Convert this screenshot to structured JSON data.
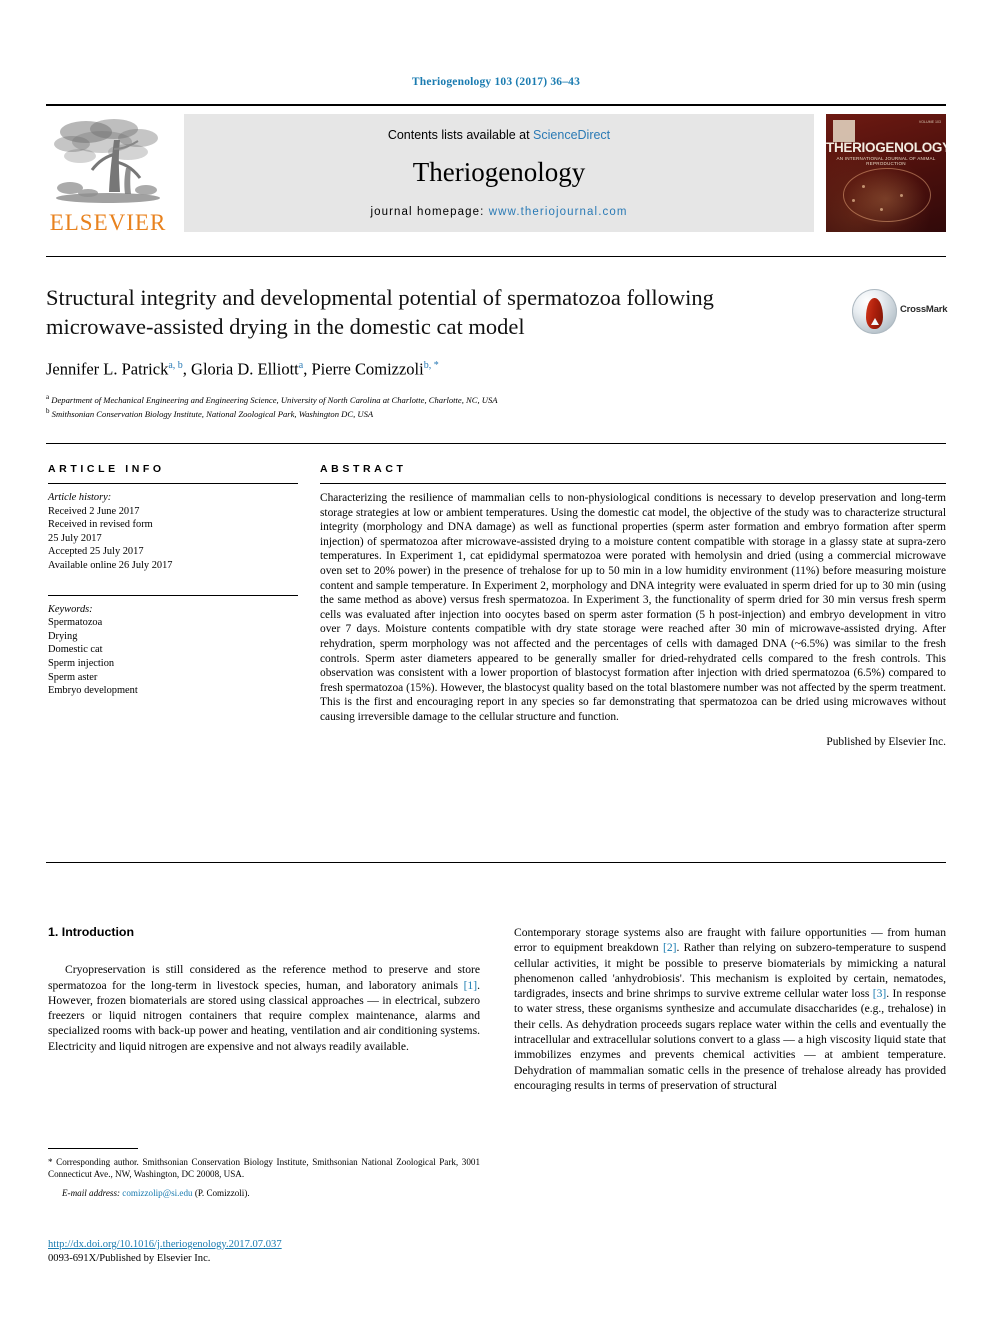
{
  "running_head": "Theriogenology 103 (2017) 36–43",
  "masthead": {
    "publisher_logo_name": "elsevier-tree-logo",
    "publisher_word": "ELSEVIER",
    "contents_prefix": "Contents lists available at ",
    "contents_link": "ScienceDirect",
    "journal_title": "Theriogenology",
    "homepage_label": "journal homepage: ",
    "homepage_url": "www.theriojournal.com",
    "cover": {
      "journal_name": "THERIOGENOLOGY",
      "subtitle": "AN INTERNATIONAL JOURNAL OF ANIMAL REPRODUCTION",
      "corner_text": "VOLUME 103"
    }
  },
  "article": {
    "title": "Structural integrity and developmental potential of spermatozoa following microwave-assisted drying in the domestic cat model",
    "authors": [
      {
        "name": "Jennifer L. Patrick",
        "marks": "a, b"
      },
      {
        "name": "Gloria D. Elliott",
        "marks": "a"
      },
      {
        "name": "Pierre Comizzoli",
        "marks": "b, *"
      }
    ],
    "affiliations": [
      {
        "mark": "a",
        "text": "Department of Mechanical Engineering and Engineering Science, University of North Carolina at Charlotte, Charlotte, NC, USA"
      },
      {
        "mark": "b",
        "text": "Smithsonian Conservation Biology Institute, National Zoological Park, Washington DC, USA"
      }
    ],
    "crossmark_label": "CrossMark"
  },
  "article_info": {
    "heading": "ARTICLE INFO",
    "history_label": "Article history:",
    "history": [
      "Received 2 June 2017",
      "Received in revised form",
      "25 July 2017",
      "Accepted 25 July 2017",
      "Available online 26 July 2017"
    ],
    "keywords_label": "Keywords:",
    "keywords": [
      "Spermatozoa",
      "Drying",
      "Domestic cat",
      "Sperm injection",
      "Sperm aster",
      "Embryo development"
    ]
  },
  "abstract": {
    "heading": "ABSTRACT",
    "text": "Characterizing the resilience of mammalian cells to non-physiological conditions is necessary to develop preservation and long-term storage strategies at low or ambient temperatures. Using the domestic cat model, the objective of the study was to characterize structural integrity (morphology and DNA damage) as well as functional properties (sperm aster formation and embryo formation after sperm injection) of spermatozoa after microwave-assisted drying to a moisture content compatible with storage in a glassy state at supra-zero temperatures. In Experiment 1, cat epididymal spermatozoa were porated with hemolysin and dried (using a commercial microwave oven set to 20% power) in the presence of trehalose for up to 50 min in a low humidity environment (11%) before measuring moisture content and sample temperature. In Experiment 2, morphology and DNA integrity were evaluated in sperm dried for up to 30 min (using the same method as above) versus fresh spermatozoa. In Experiment 3, the functionality of sperm dried for 30 min versus fresh sperm cells was evaluated after injection into oocytes based on sperm aster formation (5 h post-injection) and embryo development in vitro over 7 days. Moisture contents compatible with dry state storage were reached after 30 min of microwave-assisted drying. After rehydration, sperm morphology was not affected and the percentages of cells with damaged DNA (~6.5%) was similar to the fresh controls. Sperm aster diameters appeared to be generally smaller for dried-rehydrated cells compared to the fresh controls. This observation was consistent with a lower proportion of blastocyst formation after injection with dried spermatozoa (6.5%) compared to fresh spermatozoa (15%). However, the blastocyst quality based on the total blastomere number was not affected by the sperm treatment. This is the first and encouraging report in any species so far demonstrating that spermatozoa can be dried using microwaves without causing irreversible damage to the cellular structure and function.",
    "published_by": "Published by Elsevier Inc."
  },
  "body": {
    "section_heading": "1. Introduction",
    "left_paragraph_part1": "Cryopreservation is still considered as the reference method to preserve and store spermatozoa for the long-term in livestock species, human, and laboratory animals ",
    "left_cite1": "[1]",
    "left_paragraph_part2": ". However, frozen biomaterials are stored using classical approaches — in electrical, subzero freezers or liquid nitrogen containers that require complex maintenance, alarms and specialized rooms with back-up power and heating, ventilation and air conditioning systems. Electricity and liquid nitrogen are expensive and not always readily available.",
    "right_paragraph_part1": "Contemporary storage systems also are fraught with failure opportunities — from human error to equipment breakdown ",
    "right_cite1": "[2]",
    "right_paragraph_part2": ". Rather than relying on subzero-temperature to suspend cellular activities, it might be possible to preserve biomaterials by mimicking a natural phenomenon called 'anhydrobiosis'. This mechanism is exploited by certain, nematodes, tardigrades, insects and brine shrimps to survive extreme cellular water loss ",
    "right_cite2": "[3]",
    "right_paragraph_part3": ". In response to water stress, these organisms synthesize and accumulate disaccharides (e.g., trehalose) in their cells. As dehydration proceeds sugars replace water within the cells and eventually the intracellular and extracellular solutions convert to a glass — a high viscosity liquid state that immobilizes enzymes and prevents chemical activities — at ambient temperature. Dehydration of mammalian somatic cells in the presence of trehalose already has provided encouraging results in terms of preservation of structural"
  },
  "footnotes": {
    "corresponding": "* Corresponding author. Smithsonian Conservation Biology Institute, Smithsonian National Zoological Park, 3001 Connecticut Ave., NW, Washington, DC 20008, USA.",
    "email_label": "E-mail address: ",
    "email": "comizzolip@si.edu",
    "email_suffix": " (P. Comizzoli)."
  },
  "imprint": {
    "doi": "http://dx.doi.org/10.1016/j.theriogenology.2017.07.037",
    "issn_line": "0093-691X/Published by Elsevier Inc."
  },
  "colors": {
    "link_blue": "#1a7bb0",
    "elsevier_orange": "#e8821e",
    "banner_gray": "#e6e6e6",
    "cover_maroon": "#5c1410"
  }
}
